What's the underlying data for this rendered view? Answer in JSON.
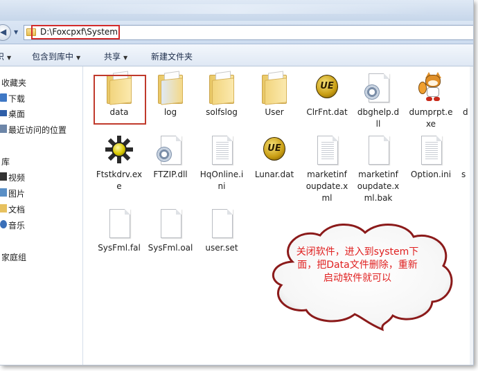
{
  "address": {
    "path": "D:\\Foxcpxf\\System"
  },
  "toolbar": {
    "items": [
      "包含到库中",
      "共享",
      "新建文件夹"
    ],
    "left_clip": "织"
  },
  "sidebar": {
    "items": [
      {
        "label": "收藏夹"
      },
      {
        "label": "下载"
      },
      {
        "label": "桌面"
      },
      {
        "label": "最近访问的位置"
      },
      {
        "label": "库"
      },
      {
        "label": "视频"
      },
      {
        "label": "图片"
      },
      {
        "label": "文档"
      },
      {
        "label": "音乐"
      },
      {
        "label": "家庭组"
      }
    ]
  },
  "files": [
    {
      "name": "data",
      "icon": "folder-icon"
    },
    {
      "name": "log",
      "icon": "folder-icon"
    },
    {
      "name": "solfslog",
      "icon": "folder-icon"
    },
    {
      "name": "User",
      "icon": "folder-icon"
    },
    {
      "name": "ClrFnt.dat",
      "icon": "ue-icon"
    },
    {
      "name": "dbghelp.dll",
      "icon": "gear-doc-icon"
    },
    {
      "name": "dumprpt.exe",
      "icon": "fox-icon"
    },
    {
      "name": "Ftstkdrv.exe",
      "icon": "sun-icon"
    },
    {
      "name": "FTZIP.dll",
      "icon": "gear-doc-icon"
    },
    {
      "name": "HqOnline.ini",
      "icon": "text-doc-icon"
    },
    {
      "name": "Lunar.dat",
      "icon": "ue-icon"
    },
    {
      "name": "marketinfoupdate.xml",
      "icon": "text-doc-icon"
    },
    {
      "name": "marketinfoupdate.xml.bak",
      "icon": "doc-icon"
    },
    {
      "name": "Option.ini",
      "icon": "text-doc-icon"
    },
    {
      "name": "SysFml.fal",
      "icon": "doc-icon"
    },
    {
      "name": "SysFml.oal",
      "icon": "doc-icon"
    },
    {
      "name": "user.set",
      "icon": "doc-icon"
    }
  ],
  "file_labels": {
    "data": "data",
    "log": "log",
    "solfslog": "solfslog",
    "user": "User",
    "clrfnt": "ClrFnt.dat",
    "dbghelp_1": "dbghelp.d",
    "dbghelp_2": "ll",
    "dumprpt_1": "dumprpt.e",
    "dumprpt_2": "xe",
    "ftstkdrv_1": "Ftstkdrv.ex",
    "ftstkdrv_2": "e",
    "ftzip": "FTZIP.dll",
    "hqonline_1": "HqOnline.i",
    "hqonline_2": "ni",
    "lunar": "Lunar.dat",
    "market_1": "marketinf",
    "market_2": "oupdate.x",
    "market_3": "ml",
    "marketbak_1": "marketinf",
    "marketbak_2": "oupdate.x",
    "marketbak_3": "ml.bak",
    "option": "Option.ini",
    "sysfmlfal": "SysFml.fal",
    "sysfmloal": "SysFml.oal",
    "userset": "user.set",
    "clip_d": "d",
    "clip_s": "s"
  },
  "callout": {
    "line1": "关闭软件，进入到system下",
    "line2": "面，把Data文件删除，重新",
    "line3": "启动软件就可以"
  },
  "colors": {
    "annotation_red": "#d22a2a",
    "callout_text": "#e02020"
  }
}
